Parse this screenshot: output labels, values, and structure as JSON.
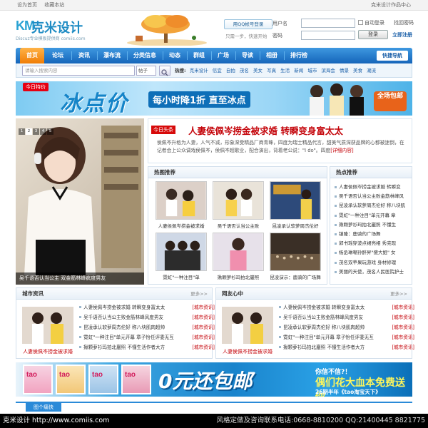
{
  "topbar": {
    "set_home": "设为首页",
    "bookmark": "收藏本站",
    "right_text": "克米设计作品中心"
  },
  "logo": {
    "mark": "KM",
    "name": "克米设计",
    "subtitle": "Discuz专业模板提供商  comiis.com"
  },
  "header": {
    "qq_login": "用QQ帐号登录",
    "qq_tip": "只需一步，快速开始"
  },
  "login": {
    "username_label": "用户名",
    "password_label": "密码",
    "remember": "自动登录",
    "forgot": "找回密码",
    "login_button": "登录",
    "register": "立即注册"
  },
  "nav": {
    "items": [
      "首页",
      "论坛",
      "资讯",
      "瀑布流",
      "分类信息",
      "动态",
      "群组",
      "广场",
      "导读",
      "相册",
      "排行榜"
    ],
    "quick": "快捷导航"
  },
  "search": {
    "placeholder": "请输入搜索内容",
    "type": "帖子",
    "hot_label": "热搜:",
    "hot": [
      "克米设计",
      "信宜",
      "自拍",
      "茂名",
      "美女",
      "写真",
      "生活",
      "新闻",
      "城市",
      "滨海会",
      "情景",
      "美食",
      "潮流"
    ]
  },
  "banner1": {
    "tag": "今日特价",
    "big": "冰点价",
    "sub": "每小时降1折 直至冰点",
    "right": "全场包邮"
  },
  "feature": {
    "pages": [
      "1",
      "2",
      "3",
      "4",
      "5"
    ],
    "caption": "吴千语否认当公主 双金筋林峰疯度男友"
  },
  "headline": {
    "badge": "今日头条",
    "title": "人妻侯佩岑捞金被求婚 转瞬变身富太太",
    "text": "侯佩岑升格为人妻，人气不减，形象深受精品厂商青睐，四度为瑞士精品代言，甜美气质深获品牌的心都被迷倒，在记者会上公众调戏侯佩岑，侯佩岑超歌业，配合演出，背着老公说：\"I do\"。四度",
    "more": "[详细内容]"
  },
  "hotpics": {
    "title": "热图推荐",
    "items": [
      "人妻侯佩岑捞金被求婚",
      "吴千语否认当公主败",
      "昆凌承认软萝周杰伦好",
      "霓虹\"一种注目\"单",
      "揪颗萝衫玛拍北巖照",
      "昆凌演示：鹿骑的广场舞"
    ]
  },
  "hotnews": {
    "title": "热点推荐",
    "items": [
      "人妻侯佩岑捞金被求婚 转瞬变",
      "吴千语否认当公主败金筋林峰风",
      "昆凌承认软萝周杰伦好 称八块肌",
      "霓虹\"一种注目\"单元开幕 章",
      "揪颗萝衫玛拍北巖照 不懂生",
      "镇隆：鹿骑的广场舞",
      "郭书瑶穿波点裙亮相 秀完现",
      "杨丞琳嘲孙醉昇\"傻大姐\" 女",
      "茂名双苹果玩游戏 身材修理",
      "美丽的天使，茂名人民医院护士"
    ]
  },
  "city": {
    "title": "城市资讯",
    "more": "更多>>",
    "pic_caption": "人妻侯佩岑捞金被求婚",
    "rows": [
      {
        "t": "人妻侯佩岑捞金被求婚 转瞬变身富太太",
        "s": "[城市资讯]"
      },
      {
        "t": "吴千语否认当公主败金筋林峰风度男友",
        "s": "[城市资讯]"
      },
      {
        "t": "昆凌承认软萝周杰伦好 称八块肌肉超帅",
        "s": "[城市资讯]"
      },
      {
        "t": "霓虹\"一种注目\"单元开幕 章子怡任评委无互",
        "s": "[城市资讯]"
      },
      {
        "t": "揪颗萝衫玛拍北巖照 不懂生活作者大方",
        "s": "[城市资讯]"
      }
    ]
  },
  "friends": {
    "title": "网友心中",
    "more": "更多>>",
    "pic_caption": "人妻侯佩岑捞金被求婚",
    "rows": [
      {
        "t": "人妻侯佩岑捞金被求婚 转瞬变身富太太",
        "s": "[城市资讯]"
      },
      {
        "t": "吴千语否认当公主败金筋林峰风度男友",
        "s": "[城市资讯]"
      },
      {
        "t": "昆凌承认软萝周杰伦好 称八块肌肉超帅",
        "s": "[城市资讯]"
      },
      {
        "t": "霓虹\"一种注目\"单元开幕 章子怡任评委无互",
        "s": "[城市资讯]"
      },
      {
        "t": "揪颗萝衫玛拍北巖照 不懂生活作者大方",
        "s": "[城市资讯]"
      }
    ]
  },
  "banner2": {
    "big": "0元还包邮",
    "t1": "你信不信?！",
    "t2": "偶们花大血本免费送你",
    "t3": "26期半年《tao淘宝天下》",
    "mag": "tao"
  },
  "section_tab": "图个痛快",
  "footer": {
    "left": "克米设计 http://www.comiis.com",
    "right": "风格定做及咨询联系电话:0668-8810200  QQ:21400445 8821775"
  },
  "colors": {
    "nav_blue": "#1565ba",
    "home_orange": "#f07d06",
    "headline_red": "#c4040a"
  }
}
